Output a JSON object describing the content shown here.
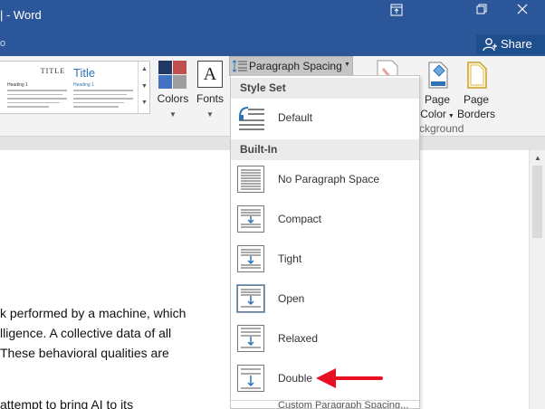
{
  "window": {
    "title": "| - Word",
    "share_label": "Share",
    "tab_stub": "o"
  },
  "ribbon": {
    "style_gallery": {
      "card1": {
        "title": "Title",
        "heading": "Heading 1"
      },
      "card2": {
        "title": "Title",
        "heading": "Heading 1"
      }
    },
    "colors_label": "Colors",
    "fonts_label": "Fonts",
    "fonts_icon_glyph": "A",
    "paragraph_spacing_label": "Paragraph Spacing",
    "page_color_label_1": "Page",
    "page_color_label_2": "Color",
    "page_borders_label_1": "Page",
    "page_borders_label_2": "Borders",
    "background_group_label": "ckground",
    "color_swatches": [
      "#1f3864",
      "#c0504d",
      "#4472c4",
      "#9e9e9e"
    ]
  },
  "dropdown": {
    "style_set_header": "Style Set",
    "default_label": "Default",
    "built_in_header": "Built-In",
    "items": [
      {
        "label": "No Paragraph Space",
        "icon": "no-paragraph-space-icon"
      },
      {
        "label": "Compact",
        "icon": "compact-spacing-icon"
      },
      {
        "label": "Tight",
        "icon": "tight-spacing-icon"
      },
      {
        "label": "Open",
        "icon": "open-spacing-icon",
        "highlighted": true
      },
      {
        "label": "Relaxed",
        "icon": "relaxed-spacing-icon"
      },
      {
        "label": "Double",
        "icon": "double-spacing-icon"
      }
    ],
    "more_label": "Custom Paragraph Spacing..."
  },
  "document": {
    "lines": [
      "k performed by a machine, which",
      "lligence. A collective data of all",
      " These behavioral qualities are",
      "attempt to bring AI to its"
    ]
  },
  "annotation": {
    "arrow_color": "#e81123",
    "points_to": "Double"
  },
  "colors": {
    "titlebar": "#2b579a",
    "ribbon": "#f3f3f3",
    "accent_blue": "#2e74b5"
  }
}
